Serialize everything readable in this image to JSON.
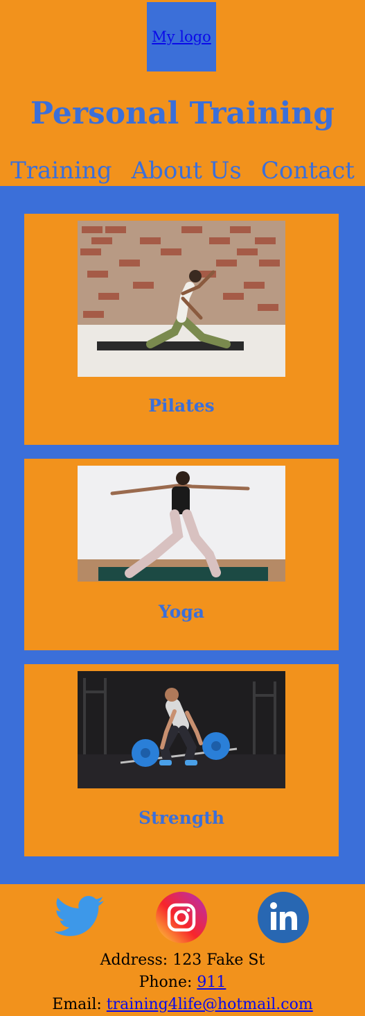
{
  "header": {
    "logo_text": "My logo",
    "title": "Personal Training",
    "nav": [
      "Training",
      "About Us",
      "Contact"
    ]
  },
  "cards": [
    {
      "label": "Pilates",
      "image": "pilates-photo"
    },
    {
      "label": "Yoga",
      "image": "yoga-photo"
    },
    {
      "label": "Strength",
      "image": "strength-photo"
    }
  ],
  "footer": {
    "social": [
      "twitter-icon",
      "instagram-icon",
      "linkedin-icon"
    ],
    "address_label": "Address:",
    "address_value": "123 Fake St",
    "phone_label": "Phone:",
    "phone_value": "911",
    "email_label": "Email:",
    "email_value": "training4life@hotmail.com"
  },
  "colors": {
    "orange": "#f2921c",
    "blue": "#3b6fd9",
    "link": "#0a0ae8"
  }
}
